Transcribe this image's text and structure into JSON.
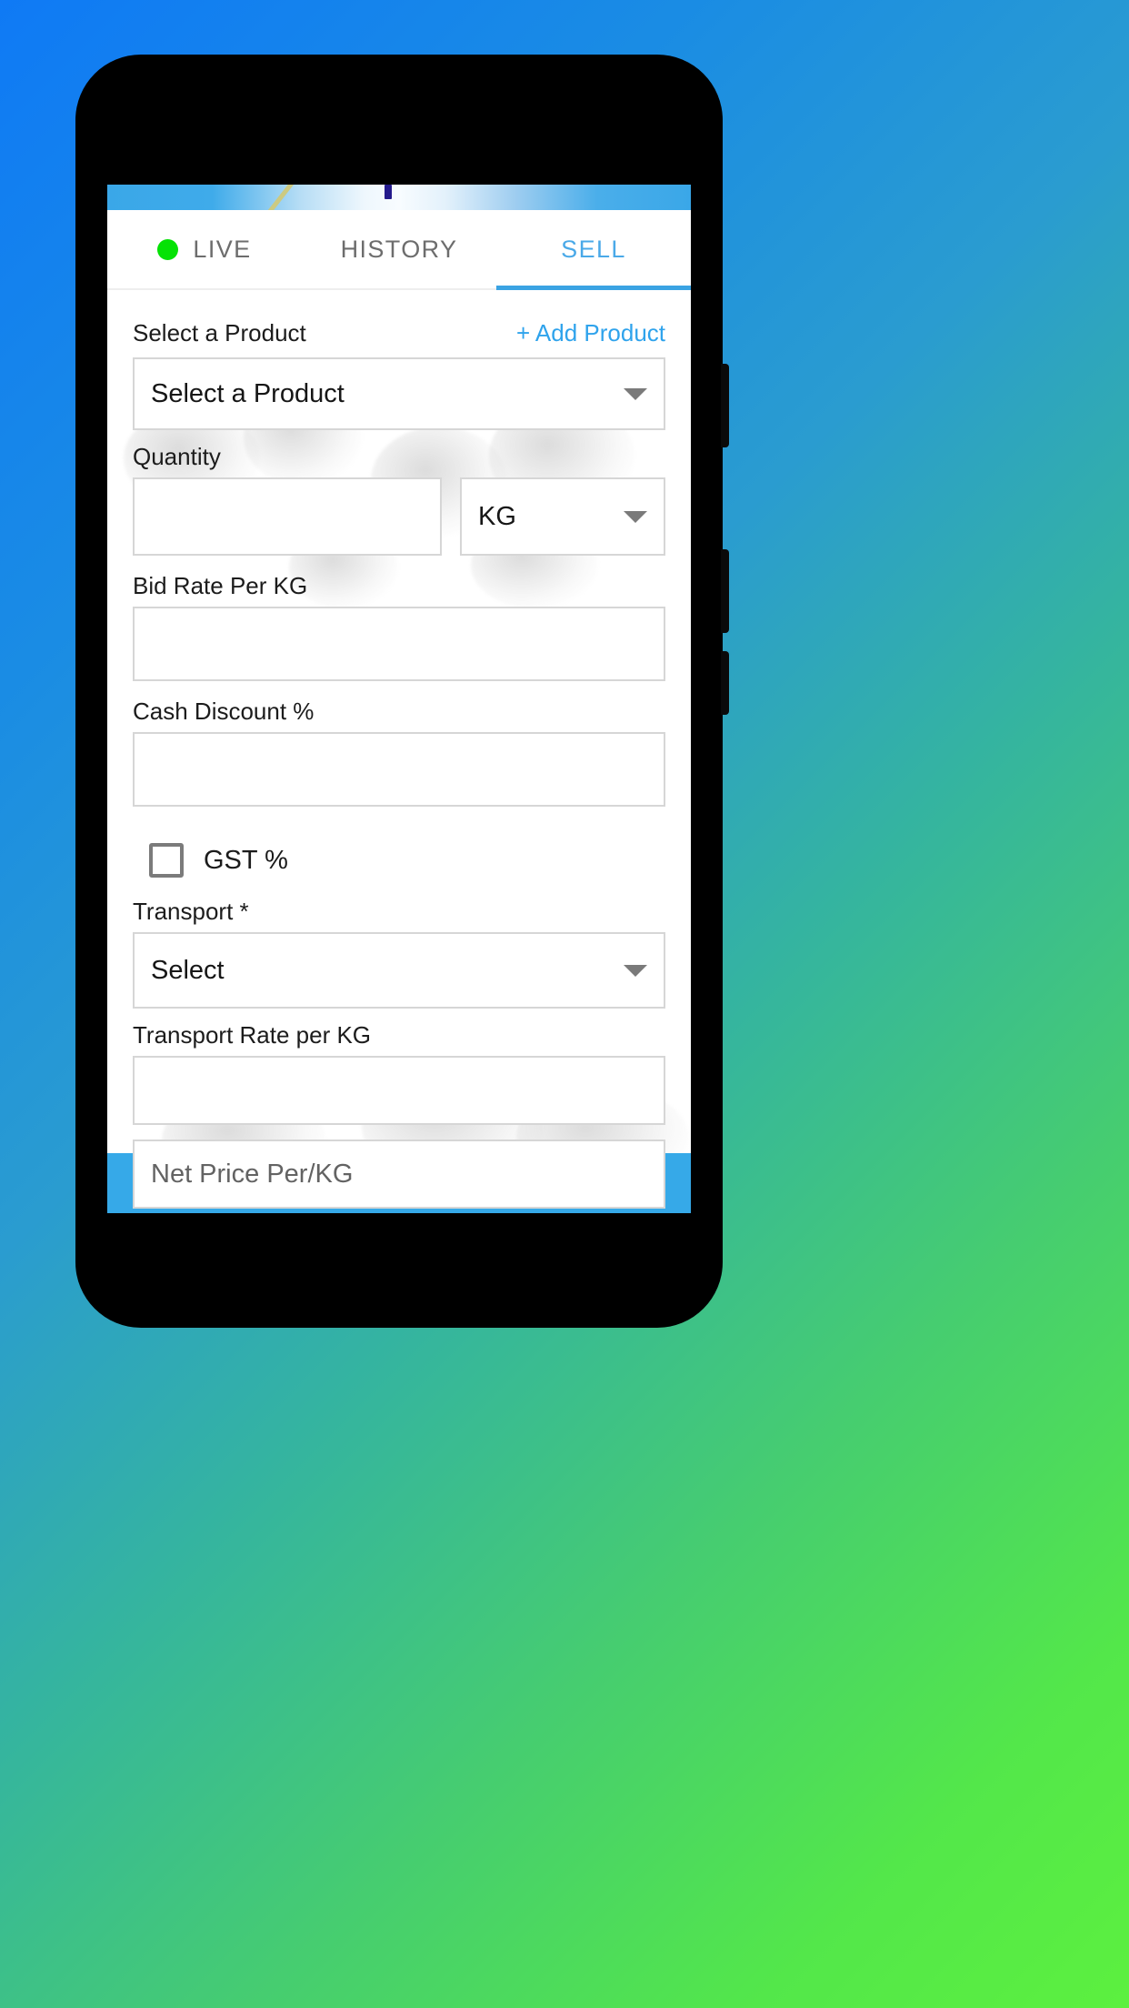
{
  "app": {
    "status_bar": {
      "marker": "notification-marker"
    },
    "tabs": [
      {
        "label": "LIVE",
        "icon": "live-dot-icon",
        "active": false
      },
      {
        "label": "HISTORY",
        "icon": "",
        "active": false
      },
      {
        "label": "SELL",
        "icon": "",
        "active": true
      }
    ],
    "form": {
      "select_product": {
        "label": "Select a Product",
        "add_link": "+ Add Product",
        "value": "Select a Product",
        "caret_icon": "chevron-down-icon"
      },
      "quantity": {
        "label": "Quantity",
        "value": "",
        "unit_value": "KG",
        "unit_caret_icon": "chevron-down-icon"
      },
      "bid_rate": {
        "label": "Bid Rate Per KG",
        "value": ""
      },
      "cash_discount": {
        "label": "Cash Discount %",
        "value": ""
      },
      "gst": {
        "label": "GST %",
        "checked": false,
        "checkbox_icon": "checkbox-unchecked-icon"
      },
      "transport": {
        "label": "Transport *",
        "value": "Select",
        "caret_icon": "chevron-down-icon"
      },
      "transport_rate": {
        "label": "Transport Rate per KG",
        "value": ""
      },
      "net_price": {
        "placeholder": "Net Price Per/KG",
        "value": ""
      }
    },
    "bottom_nav": [
      {
        "name": "cast-screen-icon",
        "active": true
      },
      {
        "name": "document-icon",
        "active": false
      },
      {
        "name": "person-icon",
        "active": false
      },
      {
        "name": "notification-bell-icon",
        "active": false
      }
    ]
  },
  "colors": {
    "accent_blue": "#36a9e8",
    "tab_active": "#4aa9e8",
    "live_green": "#05e205",
    "link_blue": "#2fa3ec",
    "bg_start": "#0f7af5",
    "bg_end": "#5cf03f",
    "frame_black": "#000000"
  }
}
